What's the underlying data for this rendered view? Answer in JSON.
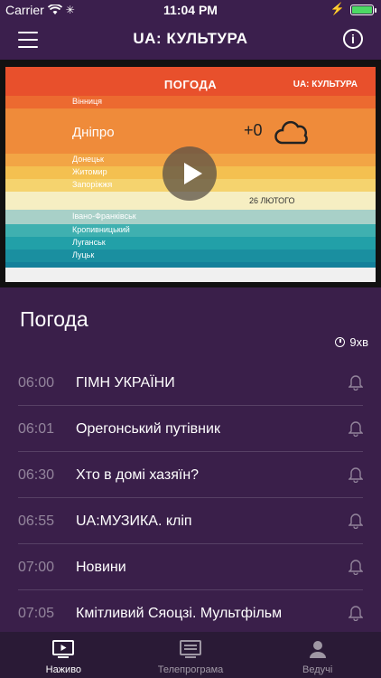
{
  "status": {
    "carrier": "Carrier",
    "time": "11:04 PM"
  },
  "header": {
    "logo": "UA: КУЛЬТУРА"
  },
  "video": {
    "title": "ПОГОДА",
    "channel_logo": "UA: КУЛЬТУРА",
    "main_city": "Дніпро",
    "temperature": "+0",
    "date": "26 ЛЮТОГО",
    "cities": {
      "vinnytsia": "Вінниця",
      "donetsk": "Донецьк",
      "zhytomyr": "Житомир",
      "zaporizhzhia": "Запоріжжя",
      "ivano_frankivsk": "Івано-Франківськ",
      "kropyvnytskyi": "Кропивницький",
      "luhansk": "Луганськ",
      "lutsk": "Луцьк"
    }
  },
  "program": {
    "title": "Погода",
    "duration": "9хв"
  },
  "schedule": [
    {
      "time": "06:00",
      "name": " ГІМН УКРАЇНИ"
    },
    {
      "time": "06:01",
      "name": "Орегонський путівник"
    },
    {
      "time": "06:30",
      "name": "Хто в домі хазяїн?"
    },
    {
      "time": "06:55",
      "name": "UA:МУЗИКА. кліп"
    },
    {
      "time": "07:00",
      "name": "Новини"
    },
    {
      "time": "07:05",
      "name": "Кмітливий Сяоцзі. Мультфільм"
    }
  ],
  "tabs": [
    {
      "label": "Наживо",
      "icon": "tv-icon",
      "active": true
    },
    {
      "label": "Телепрограма",
      "icon": "schedule-icon",
      "active": false
    },
    {
      "label": "Ведучі",
      "icon": "person-icon",
      "active": false
    }
  ],
  "colors": {
    "background": "#3a1f4a",
    "navbar": "#3b1f4d",
    "tabbar": "#2a1a36"
  }
}
